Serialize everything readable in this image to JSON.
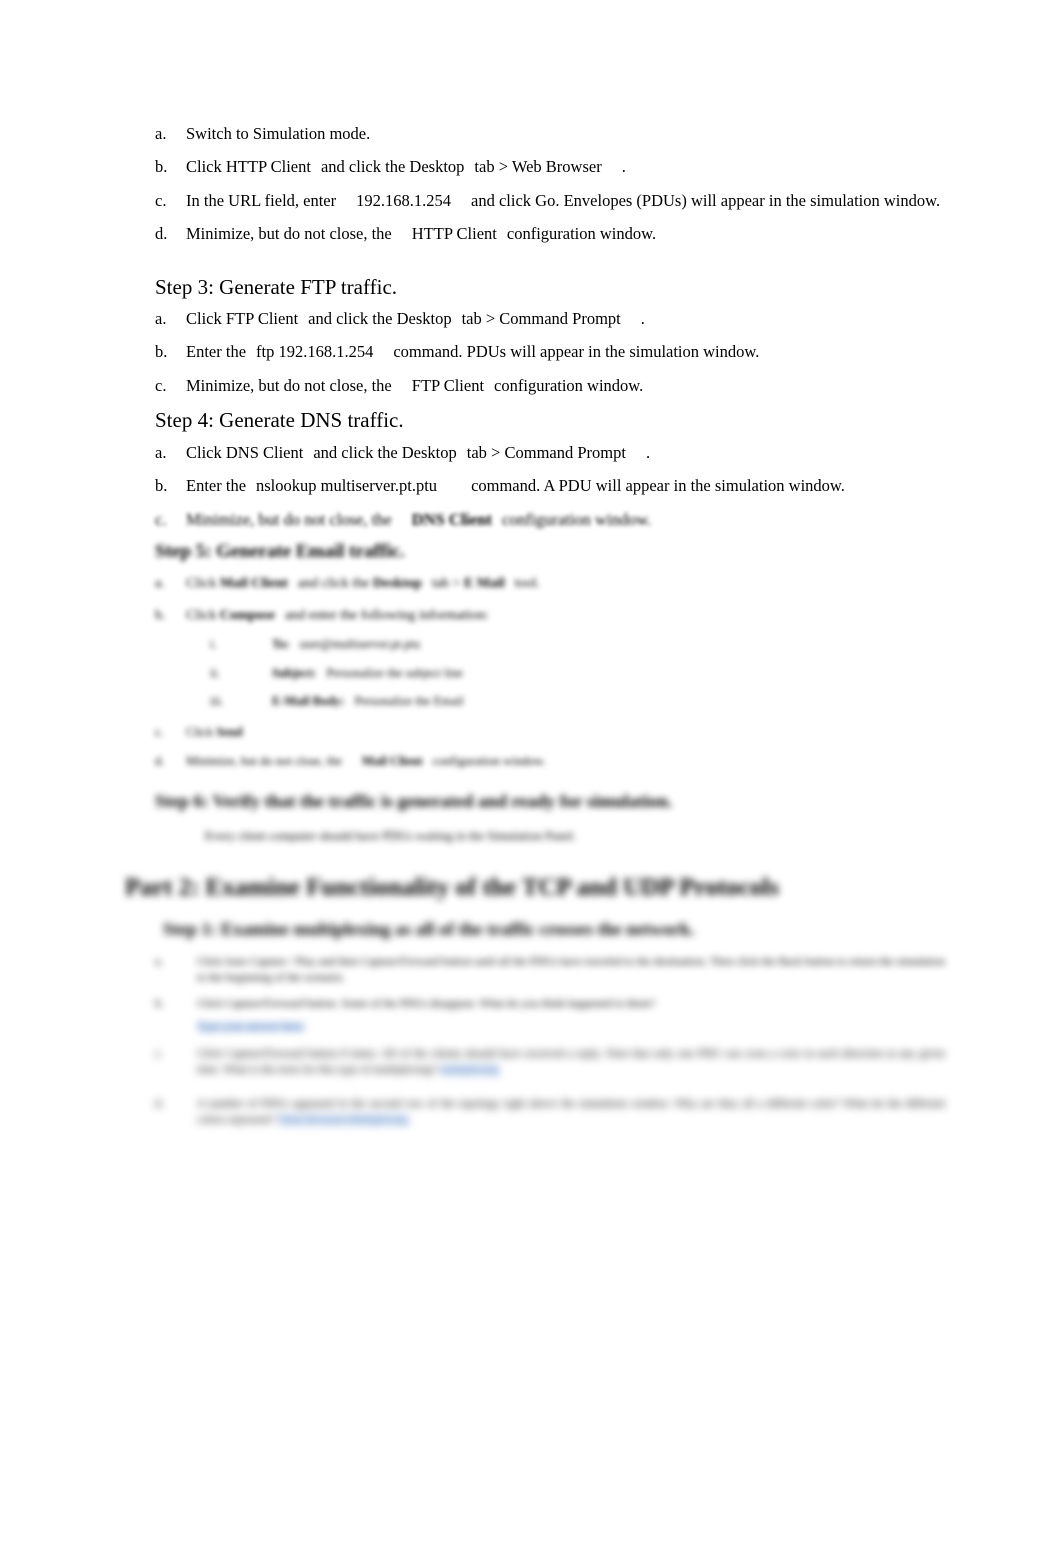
{
  "document": {
    "background_color": "#ffffff",
    "text_color": "#000000",
    "link_color": "#3b6fbf",
    "link_highlight_color": "#dce6f4"
  },
  "step2": {
    "items": [
      {
        "marker": "a.",
        "text": "Switch to Simulation mode."
      },
      {
        "marker": "b.",
        "text_parts": [
          "Click",
          "HTTP Client",
          "and click the",
          "Desktop",
          "tab >",
          "Web Browser",
          "."
        ]
      },
      {
        "marker": "c.",
        "text_parts": [
          "In the URL field, enter",
          "192.168.1.254",
          "and click",
          "Go",
          ". Envelopes (PDUs) will appear in the simulation window."
        ]
      },
      {
        "marker": "d.",
        "text_parts": [
          "Minimize, but do not close, the",
          "HTTP Client",
          "configuration window."
        ]
      }
    ]
  },
  "step3": {
    "heading": "Step 3: Generate FTP traffic.",
    "items": [
      {
        "marker": "a.",
        "text_parts": [
          "Click",
          "FTP Client",
          "and click the",
          "Desktop",
          "tab >",
          "Command Prompt",
          "."
        ]
      },
      {
        "marker": "b.",
        "text_parts": [
          "Enter the",
          "ftp 192.168.1.254",
          "command. PDUs will appear in the simulation window."
        ]
      },
      {
        "marker": "c.",
        "text_parts": [
          "Minimize, but do not close, the",
          "FTP Client",
          "configuration window."
        ]
      }
    ]
  },
  "step4": {
    "heading": "Step 4: Generate DNS traffic.",
    "items": [
      {
        "marker": "a.",
        "text_parts": [
          "Click",
          "DNS Client",
          "and click the",
          "Desktop",
          "tab >",
          "Command Prompt",
          "."
        ]
      },
      {
        "marker": "b.",
        "text_parts": [
          "Enter the",
          "nslookup multiserver.pt.ptu",
          "command. A PDU will appear in the simulation window."
        ]
      },
      {
        "marker": "c.",
        "text_parts": [
          "Minimize, but do not close, the",
          "DNS Client",
          "configuration window."
        ]
      }
    ]
  },
  "step5": {
    "heading": "Step 5: Generate Email traffic.",
    "items": [
      {
        "marker": "a.",
        "text_parts": [
          "Click",
          "Mail Client",
          "and click the",
          "Desktop",
          "tab >",
          "E Mail",
          "tool."
        ]
      },
      {
        "marker": "b.",
        "text_parts": [
          "Click",
          "Compose",
          "and enter the following information:"
        ]
      },
      {
        "marker": "c.",
        "text_parts": [
          "Click",
          "Send"
        ]
      },
      {
        "marker": "d.",
        "text_parts": [
          "Minimize, but do not close, the",
          "Mail Client",
          "configuration window."
        ]
      }
    ],
    "subitems": [
      {
        "marker": "i.",
        "text_parts": [
          "To:",
          "user@multiserver.pt.ptu"
        ]
      },
      {
        "marker": "ii.",
        "text_parts": [
          "Subject:",
          "Personalize the subject line"
        ]
      },
      {
        "marker": "iii.",
        "text_parts": [
          "E-Mail Body:",
          "Personalize the Email"
        ]
      }
    ]
  },
  "step6": {
    "heading": "Step 6: Verify that the traffic is generated and ready for simulation.",
    "note": "Every client computer should have PDUs waiting in the Simulation Panel."
  },
  "part2": {
    "heading": "Part 2: Examine Functionality of the TCP and UDP Protocols",
    "substep": {
      "heading": "Step 1: Examine multiplexing as all of the traffic crosses the network.",
      "items": [
        {
          "marker": "a.",
          "text": "Click Auto Capture / Play and then Capture/Forward button until all the PDUs have traveled to the destination. Then click the Back button to return the simulation to the beginning of the scenario."
        },
        {
          "marker": "b.",
          "text": "Click Capture/Forward button. Some of the PDUs disappear. What do you think happened to them?"
        },
        {
          "marker": "c.",
          "text": "Click Capture/Forward button 8 times. All of the clients should have received a reply. Note that only one PDU can cross a wire in each direction at any given time. What is the term for this type of multiplexing?"
        },
        {
          "marker": "d.",
          "text": "A number of PDUs appeared in the second row of the topology right above the simulation window. Why are they all a different color? What do the different colors represent?"
        }
      ],
      "answer_links": [
        "Type your answer here.",
        "multiplexing",
        "Time-Division Multiplexing"
      ]
    }
  }
}
